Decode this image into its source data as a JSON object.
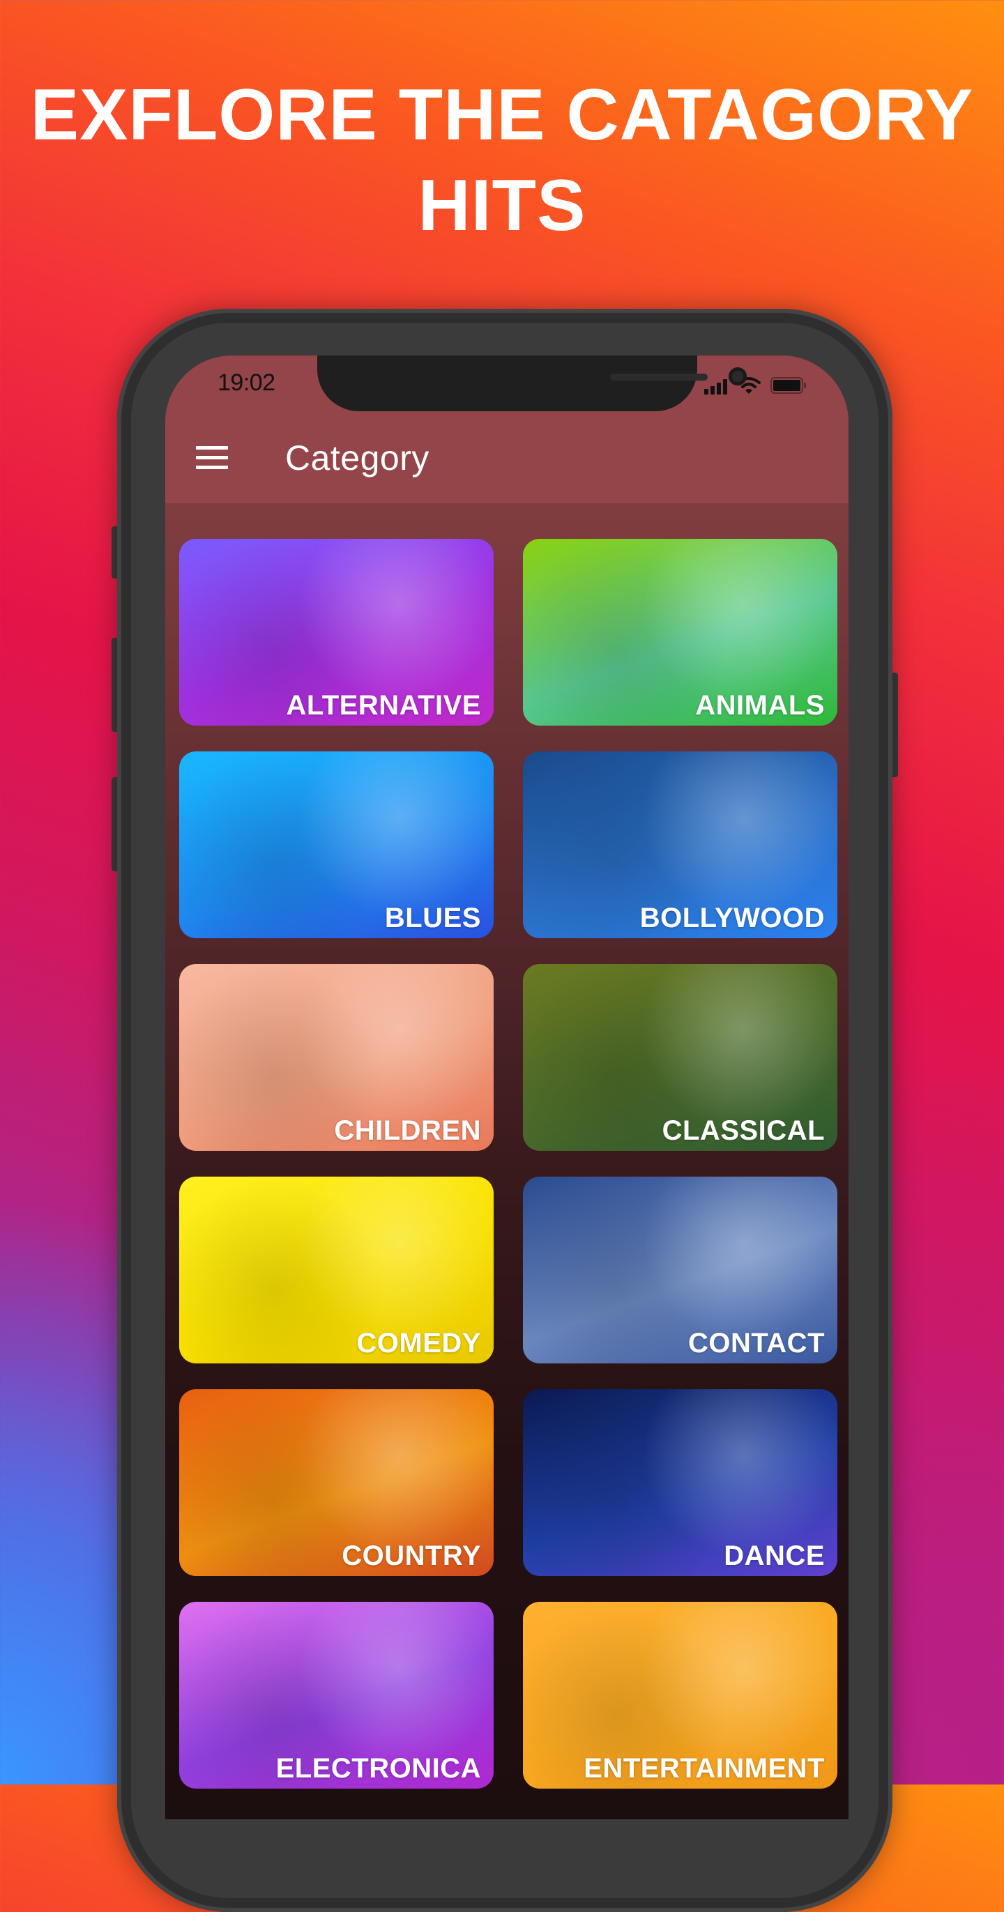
{
  "headline": {
    "line1": "EXFLORE THE CATAGORY",
    "line2": "HITS"
  },
  "status_bar": {
    "time": "19:02",
    "icons": [
      "signal-icon",
      "wifi-icon",
      "battery-icon"
    ]
  },
  "app_bar": {
    "menu_icon": "hamburger-menu-icon",
    "title": "Category"
  },
  "colors": {
    "app_bar": "#934549",
    "label_text": "#ffffff",
    "headline_text": "#ffffff"
  },
  "categories": [
    {
      "label": "ALTERNATIVE",
      "theme": [
        "#7a5cff",
        "#a030e0",
        "#c028c8"
      ]
    },
    {
      "label": "ANIMALS",
      "theme": [
        "#8ad010",
        "#58c890",
        "#2eb838"
      ]
    },
    {
      "label": "BLUES",
      "theme": [
        "#18b8ff",
        "#1e8af0",
        "#2a50e0"
      ]
    },
    {
      "label": "BOLLYWOOD",
      "theme": [
        "#1a4a8a",
        "#2a70c8",
        "#2a80f0"
      ]
    },
    {
      "label": "CHILDREN",
      "theme": [
        "#f8b8a0",
        "#f0a080",
        "#e87858"
      ]
    },
    {
      "label": "CLASSICAL",
      "theme": [
        "#6a7a20",
        "#4a6a2a",
        "#2e5a30"
      ]
    },
    {
      "label": "COMEDY",
      "theme": [
        "#fff020",
        "#f8e000",
        "#e8c800"
      ]
    },
    {
      "label": "CONTACT",
      "theme": [
        "#2a4a90",
        "#6a88c0",
        "#3a58a0"
      ]
    },
    {
      "label": "COUNTRY",
      "theme": [
        "#e86010",
        "#f09010",
        "#d04820"
      ]
    },
    {
      "label": "DANCE",
      "theme": [
        "#0a1a50",
        "#2040a8",
        "#6040d0"
      ]
    },
    {
      "label": "ELECTRONICA",
      "theme": [
        "#e070f0",
        "#9040e0",
        "#b028d0"
      ]
    },
    {
      "label": "ENTERTAINMENT",
      "theme": [
        "#ffb030",
        "#f8a820",
        "#f09818"
      ]
    }
  ]
}
